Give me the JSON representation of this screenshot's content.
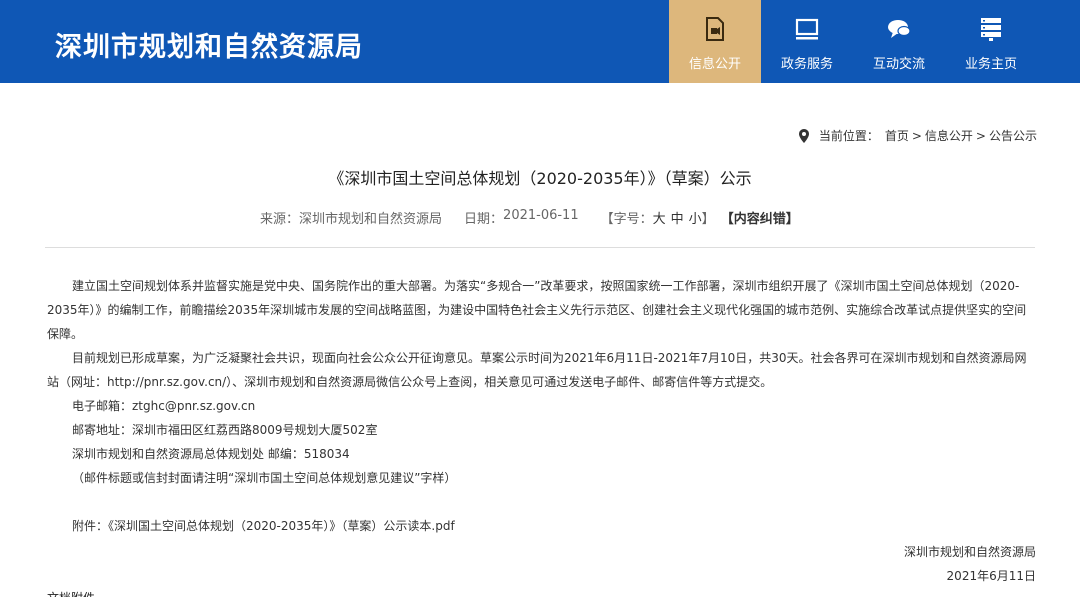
{
  "header": {
    "site_title": "深圳市规划和自然资源局",
    "nav": [
      {
        "label": "信息公开",
        "icon": "document-icon",
        "active": true
      },
      {
        "label": "政务服务",
        "icon": "monitor-icon",
        "active": false
      },
      {
        "label": "互动交流",
        "icon": "chat-icon",
        "active": false
      },
      {
        "label": "业务主页",
        "icon": "server-icon",
        "active": false
      }
    ]
  },
  "breadcrumb": {
    "prefix": "当前位置：",
    "items": [
      "首页",
      "信息公开",
      "公告公示"
    ],
    "separator": ">"
  },
  "article": {
    "title": "《深圳市国土空间总体规划（2020-2035年）》（草案）公示",
    "meta": {
      "source_label": "来源：",
      "source": "深圳市规划和自然资源局",
      "date_label": "日期：",
      "date": "2021-06-11",
      "font_size_prefix": "【字号：",
      "font_large": "大",
      "font_medium": "中",
      "font_small": "小",
      "font_size_suffix": "】",
      "error_report": "【内容纠错】"
    },
    "paragraph_1": "建立国土空间规划体系并监督实施是党中央、国务院作出的重大部署。为落实“多规合一”改革要求，按照国家统一工作部署，深圳市组织开展了《深圳市国土空间总体规划（2020-2035年）》的编制工作，前瞻描绘2035年深圳城市发展的空间战略蓝图，为建设中国特色社会主义先行示范区、创建社会主义现代化强国的城市范例、实施综合改革试点提供坚实的空间保障。",
    "paragraph_2": "目前规划已形成草案，为广泛凝聚社会共识，现面向社会公众公开征询意见。草案公示时间为2021年6月11日-2021年7月10日，共30天。社会各界可在深圳市规划和自然资源局网站（网址：http://pnr.sz.gov.cn/）、深圳市规划和自然资源局微信公众号上查阅，相关意见可通过发送电子邮件、邮寄信件等方式提交。",
    "email": "电子邮箱：ztghc@pnr.sz.gov.cn",
    "address": "邮寄地址：深圳市福田区红荔西路8009号规划大厦502室",
    "postcode": "深圳市规划和自然资源局总体规划处  邮编：518034",
    "note": "（邮件标题或信封封面请注明“深圳市国土空间总体规划意见建议”字样）",
    "attachment": "附件：《深圳国土空间总体规划（2020-2035年）》（草案）公示读本.pdf",
    "signature_org": "深圳市规划和自然资源局",
    "signature_date": "2021年6月11日",
    "cutoff_text": "文档附件"
  },
  "colors": {
    "header_blue": "#0f57b5",
    "active_tab": "#ddb77c"
  }
}
